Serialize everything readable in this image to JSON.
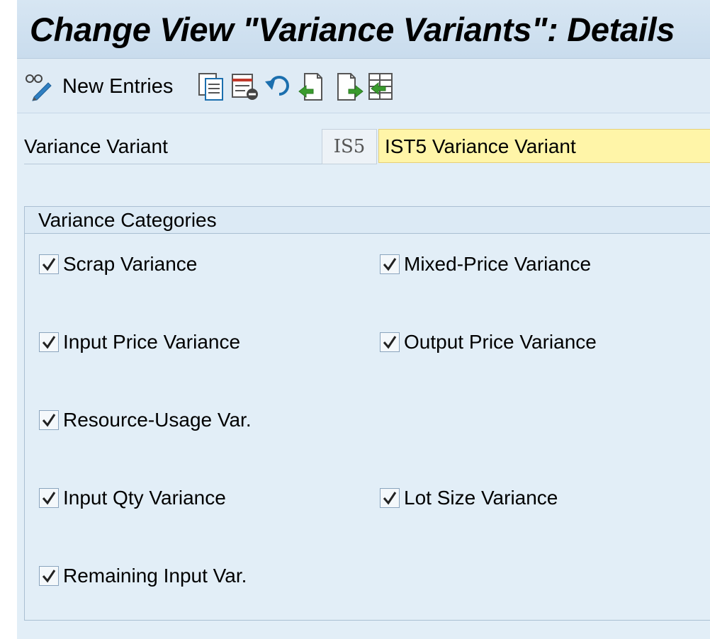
{
  "window": {
    "title": "Change View \"Variance Variants\": Details"
  },
  "toolbar": {
    "new_entries_label": "New Entries",
    "icons": [
      "display-change-icon",
      "copy-icon",
      "delete-icon",
      "undo-icon",
      "previous-entry-icon",
      "next-entry-icon",
      "select-block-icon"
    ]
  },
  "header_field": {
    "label": "Variance Variant",
    "key": "IS5",
    "value": "IST5 Variance Variant"
  },
  "group": {
    "title": "Variance Categories",
    "checkboxes": [
      {
        "label": "Scrap Variance",
        "checked": true
      },
      {
        "label": "Mixed-Price Variance",
        "checked": true
      },
      {
        "label": "Input Price Variance",
        "checked": true
      },
      {
        "label": "Output Price Variance",
        "checked": true
      },
      {
        "label": "Resource-Usage Var.",
        "checked": true
      },
      {
        "label": "Input Qty Variance",
        "checked": true
      },
      {
        "label": "Lot Size Variance",
        "checked": true
      },
      {
        "label": "Remaining Input Var.",
        "checked": true
      }
    ]
  },
  "colors": {
    "background": "#dfebf5",
    "required_field": "#fff5a8",
    "accent": "#1b6fae"
  }
}
